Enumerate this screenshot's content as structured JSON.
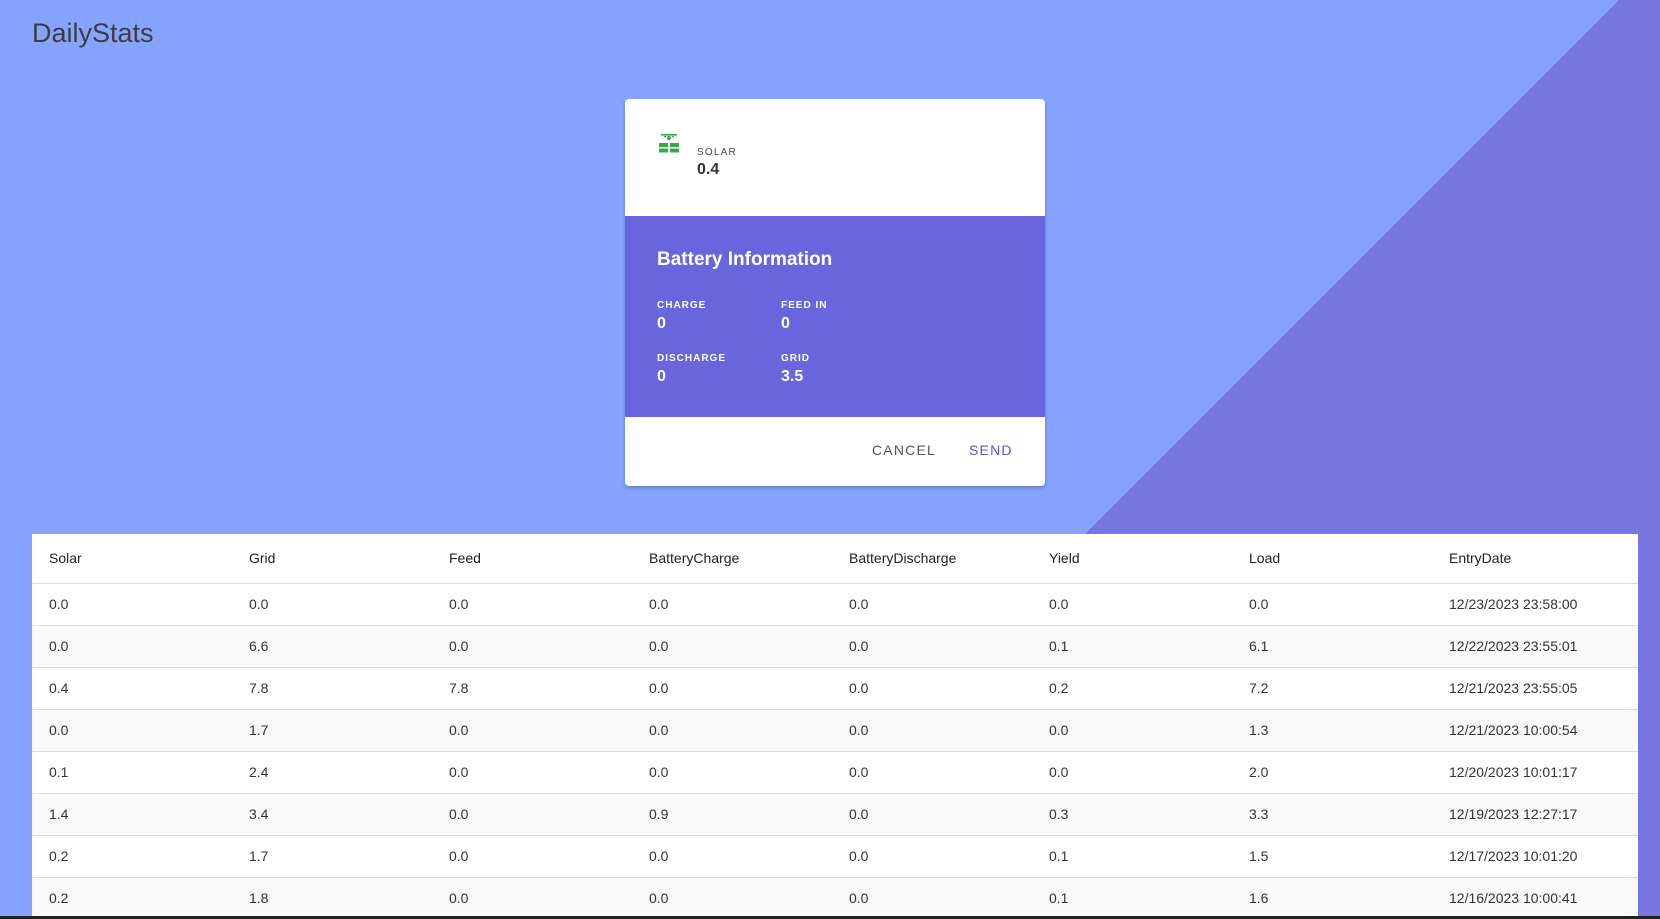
{
  "app": {
    "title": "DailyStats"
  },
  "colors": {
    "background": "#86a4ff",
    "diagonal": "#7776e0",
    "battery_panel": "#6966dd",
    "send_button": "#5a54d6",
    "solar_icon": "#3aa64a"
  },
  "card": {
    "solar": {
      "icon": "solar-panel-icon",
      "label": "SOLAR",
      "value": "0.4"
    },
    "battery": {
      "title": "Battery Information",
      "charge_label": "CHARGE",
      "charge_value": "0",
      "feedin_label": "FEED IN",
      "feedin_value": "0",
      "discharge_label": "DISCHARGE",
      "discharge_value": "0",
      "grid_label": "GRID",
      "grid_value": "3.5"
    },
    "actions": {
      "cancel_label": "CANCEL",
      "send_label": "SEND"
    }
  },
  "table": {
    "headers": [
      "Solar",
      "Grid",
      "Feed",
      "BatteryCharge",
      "BatteryDischarge",
      "Yield",
      "Load",
      "EntryDate"
    ],
    "rows": [
      [
        "0.0",
        "0.0",
        "0.0",
        "0.0",
        "0.0",
        "0.0",
        "0.0",
        "12/23/2023 23:58:00"
      ],
      [
        "0.0",
        "6.6",
        "0.0",
        "0.0",
        "0.0",
        "0.1",
        "6.1",
        "12/22/2023 23:55:01"
      ],
      [
        "0.4",
        "7.8",
        "7.8",
        "0.0",
        "0.0",
        "0.2",
        "7.2",
        "12/21/2023 23:55:05"
      ],
      [
        "0.0",
        "1.7",
        "0.0",
        "0.0",
        "0.0",
        "0.0",
        "1.3",
        "12/21/2023 10:00:54"
      ],
      [
        "0.1",
        "2.4",
        "0.0",
        "0.0",
        "0.0",
        "0.0",
        "2.0",
        "12/20/2023 10:01:17"
      ],
      [
        "1.4",
        "3.4",
        "0.0",
        "0.9",
        "0.0",
        "0.3",
        "3.3",
        "12/19/2023 12:27:17"
      ],
      [
        "0.2",
        "1.7",
        "0.0",
        "0.0",
        "0.0",
        "0.1",
        "1.5",
        "12/17/2023 10:01:20"
      ],
      [
        "0.2",
        "1.8",
        "0.0",
        "0.0",
        "0.0",
        "0.1",
        "1.6",
        "12/16/2023 10:00:41"
      ]
    ]
  }
}
